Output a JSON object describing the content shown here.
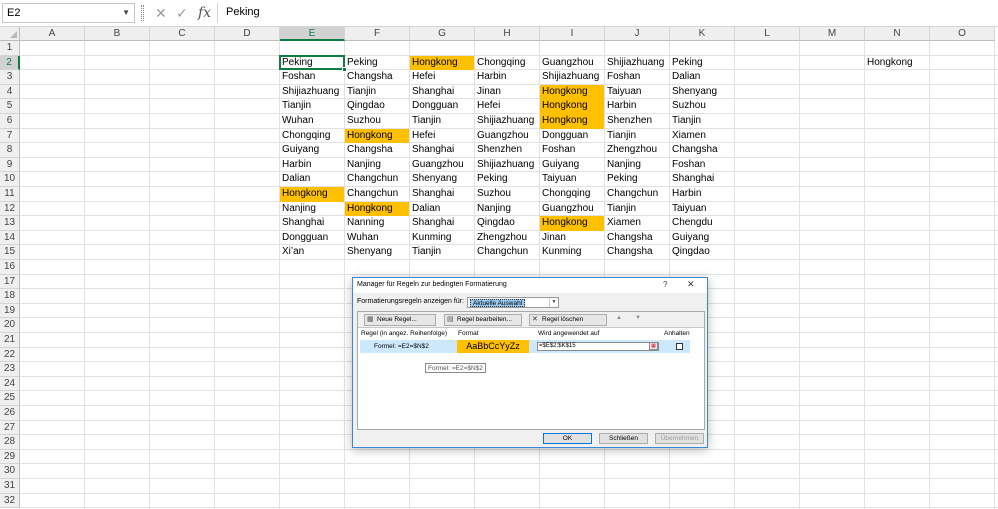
{
  "formula_bar": {
    "name_box": "E2",
    "fx_label": "fx",
    "content": "Peking"
  },
  "grid": {
    "columns": [
      "A",
      "B",
      "C",
      "D",
      "E",
      "F",
      "G",
      "H",
      "I",
      "J",
      "K",
      "L",
      "M",
      "N",
      "O"
    ],
    "active_column": "E",
    "rows": [
      "1",
      "2",
      "3",
      "4",
      "5",
      "6",
      "7",
      "8",
      "9",
      "10",
      "11",
      "12",
      "13",
      "14",
      "15",
      "16",
      "17",
      "18",
      "19",
      "20",
      "21",
      "22",
      "23",
      "24",
      "25",
      "26",
      "27",
      "28",
      "29",
      "30",
      "31",
      "32"
    ],
    "active_row": "2",
    "selected_cell": "E2",
    "highlight_color": "#ffc000",
    "table": [
      [
        "Peking",
        "Peking",
        "Hongkong",
        "Chongqing",
        "Guangzhou",
        "Shijiazhuang",
        "Peking"
      ],
      [
        "Foshan",
        "Changsha",
        "Hefei",
        "Harbin",
        "Shijiazhuang",
        "Foshan",
        "Dalian"
      ],
      [
        "Shijiazhuang",
        "Tianjin",
        "Shanghai",
        "Jinan",
        "Hongkong",
        "Taiyuan",
        "Shenyang"
      ],
      [
        "Tianjin",
        "Qingdao",
        "Dongguan",
        "Hefei",
        "Hongkong",
        "Harbin",
        "Suzhou"
      ],
      [
        "Wuhan",
        "Suzhou",
        "Tianjin",
        "Shijiazhuang",
        "Hongkong",
        "Shenzhen",
        "Tianjin"
      ],
      [
        "Chongqing",
        "Hongkong",
        "Hefei",
        "Guangzhou",
        "Dongguan",
        "Tianjin",
        "Xiamen"
      ],
      [
        "Guiyang",
        "Changsha",
        "Shanghai",
        "Shenzhen",
        "Foshan",
        "Zhengzhou",
        "Changsha"
      ],
      [
        "Harbin",
        "Nanjing",
        "Guangzhou",
        "Shijiazhuang",
        "Guiyang",
        "Nanjing",
        "Foshan"
      ],
      [
        "Dalian",
        "Changchun",
        "Shenyang",
        "Peking",
        "Taiyuan",
        "Peking",
        "Shanghai"
      ],
      [
        "Hongkong",
        "Changchun",
        "Shanghai",
        "Suzhou",
        "Chongqing",
        "Changchun",
        "Harbin"
      ],
      [
        "Nanjing",
        "Hongkong",
        "Dalian",
        "Nanjing",
        "Guangzhou",
        "Tianjin",
        "Taiyuan"
      ],
      [
        "Shanghai",
        "Nanning",
        "Shanghai",
        "Qingdao",
        "Hongkong",
        "Xiamen",
        "Chengdu"
      ],
      [
        "Dongguan",
        "Wuhan",
        "Kunming",
        "Zhengzhou",
        "Jinan",
        "Changsha",
        "Guiyang"
      ],
      [
        "Xi’an",
        "Shenyang",
        "Tianjin",
        "Changchun",
        "Kunming",
        "Changsha",
        "Qingdao"
      ]
    ],
    "criteria_cell": {
      "address": "N2",
      "value": "Hongkong"
    }
  },
  "dialog": {
    "title": "Manager für Regeln zur bedingten Formatierung",
    "help": "?",
    "close": "✕",
    "show_rules_label": "Formatierungsregeln anzeigen für:",
    "scope_value": "Aktuelle Auswahl",
    "toolbar": {
      "new_rule": "Neue Regel...",
      "edit_rule": "Regel bearbeiten...",
      "delete_rule": "Regel löschen"
    },
    "columns": {
      "rule": "Regel (in angez. Reihenfolge)",
      "format": "Format",
      "applies_to": "Wird angewendet auf",
      "stop": "Anhalten"
    },
    "rule": {
      "formula": "Formel: =E2=$N$2",
      "format_preview": "AaBbCcYyZz",
      "applies_to": "=$E$2:$K$15",
      "format_color": "#ffc000"
    },
    "tooltip": "Formel: =E2=$N$2",
    "buttons": {
      "ok": "OK",
      "close": "Schließen",
      "apply": "Übernehmen"
    }
  }
}
